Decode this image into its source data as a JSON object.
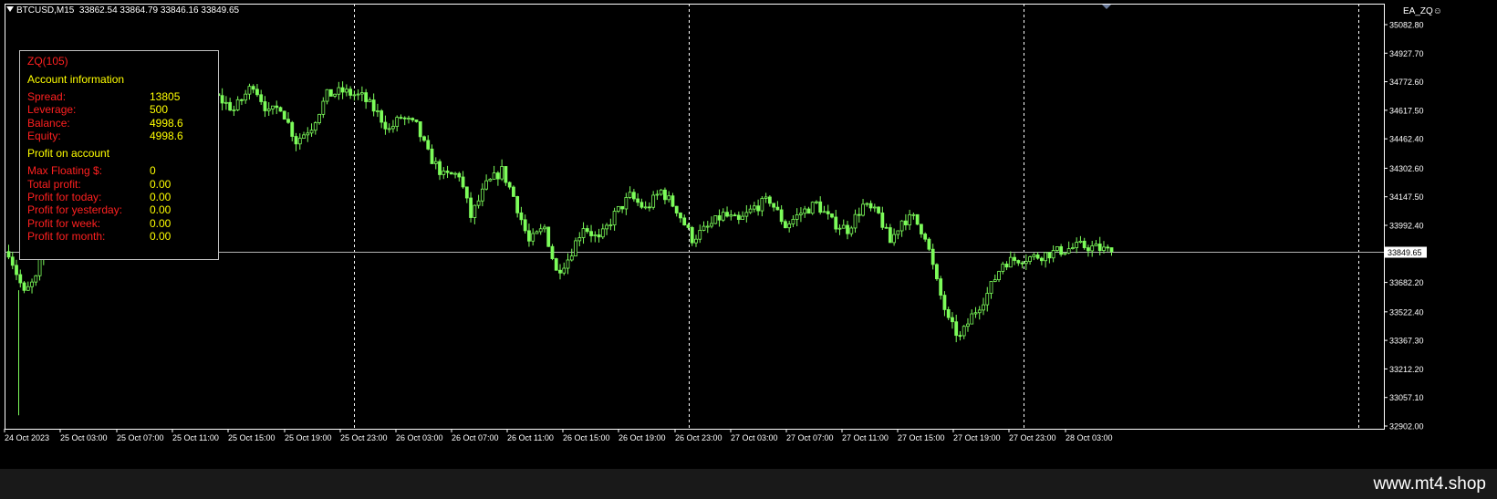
{
  "header": {
    "symbol": "BTCUSD,M15",
    "ohlc": "33862.54 33864.79 33846.16 33849.65"
  },
  "expert": {
    "label": "EA_ZQ",
    "smiley": "☺"
  },
  "panel": {
    "title": "ZQ(105)",
    "account_heading": "Account information",
    "account_rows": [
      {
        "label": "Spread:",
        "value": "13805"
      },
      {
        "label": "Leverage:",
        "value": "500"
      },
      {
        "label": "Balance:",
        "value": "4998.6"
      },
      {
        "label": "Equity:",
        "value": "4998.6"
      }
    ],
    "profit_heading": "Profit on account",
    "profit_rows": [
      {
        "label": "Max Floating $:",
        "value": "0"
      },
      {
        "label": "Total profit:",
        "value": "0.00"
      },
      {
        "label": "Profit for today:",
        "value": "0.00"
      },
      {
        "label": "Profit for yesterday:",
        "value": "0.00"
      },
      {
        "label": "Profit for week:",
        "value": "0.00"
      },
      {
        "label": "Profit for month:",
        "value": "0.00"
      }
    ]
  },
  "footer": {
    "brand": "www.mt4.shop"
  },
  "colors": {
    "candle": "#7cfc5a",
    "price_line": "#b4b4b4",
    "grid": "#ffffff",
    "label_red": "#ff2020",
    "label_yellow": "#ffff00"
  },
  "chart_data": {
    "type": "candlestick",
    "symbol": "BTCUSD",
    "timeframe": "M15",
    "current_price": 33849.65,
    "y_ticks": [
      35082.8,
      34927.7,
      34772.6,
      34617.5,
      34462.4,
      34302.6,
      34147.5,
      33992.4,
      33682.2,
      33522.4,
      33367.3,
      33212.2,
      33057.1,
      32902.0
    ],
    "ylim": [
      32902.0,
      35082.8
    ],
    "x_labels": [
      "24 Oct 2023",
      "25 Oct 03:00",
      "25 Oct 07:00",
      "25 Oct 11:00",
      "25 Oct 15:00",
      "25 Oct 19:00",
      "25 Oct 23:00",
      "26 Oct 03:00",
      "26 Oct 07:00",
      "26 Oct 11:00",
      "26 Oct 15:00",
      "26 Oct 19:00",
      "26 Oct 23:00",
      "27 Oct 03:00",
      "27 Oct 07:00",
      "27 Oct 11:00",
      "27 Oct 15:00",
      "27 Oct 19:00",
      "27 Oct 23:00",
      "28 Oct 03:00"
    ],
    "day_separators": [
      "25 Oct",
      "26 Oct",
      "27 Oct",
      "28 Oct"
    ],
    "close_path": [
      [
        0,
        33850
      ],
      [
        4,
        33620
      ],
      [
        7,
        33700
      ],
      [
        10,
        33960
      ],
      [
        12,
        33850
      ],
      [
        16,
        34000
      ],
      [
        22,
        33820
      ],
      [
        25,
        34150
      ],
      [
        32,
        34600
      ],
      [
        38,
        34600
      ],
      [
        42,
        34480
      ],
      [
        48,
        34630
      ],
      [
        53,
        34700
      ],
      [
        58,
        34620
      ],
      [
        63,
        34760
      ],
      [
        67,
        34600
      ],
      [
        70,
        34640
      ],
      [
        74,
        34450
      ],
      [
        78,
        34530
      ],
      [
        82,
        34700
      ],
      [
        86,
        34720
      ],
      [
        91,
        34690
      ],
      [
        95,
        34600
      ],
      [
        98,
        34510
      ],
      [
        101,
        34580
      ],
      [
        105,
        34530
      ],
      [
        108,
        34380
      ],
      [
        112,
        34260
      ],
      [
        116,
        34270
      ],
      [
        119,
        34040
      ],
      [
        123,
        34210
      ],
      [
        127,
        34290
      ],
      [
        130,
        34150
      ],
      [
        134,
        33900
      ],
      [
        138,
        33980
      ],
      [
        141,
        33740
      ],
      [
        144,
        33810
      ],
      [
        148,
        33990
      ],
      [
        152,
        33910
      ],
      [
        156,
        34050
      ],
      [
        160,
        34150
      ],
      [
        164,
        34080
      ],
      [
        168,
        34180
      ],
      [
        172,
        34080
      ],
      [
        176,
        33920
      ],
      [
        180,
        33980
      ],
      [
        184,
        34050
      ],
      [
        188,
        34010
      ],
      [
        192,
        34090
      ],
      [
        196,
        34130
      ],
      [
        200,
        33990
      ],
      [
        204,
        34060
      ],
      [
        208,
        34110
      ],
      [
        212,
        34010
      ],
      [
        216,
        33970
      ],
      [
        220,
        34100
      ],
      [
        224,
        34050
      ],
      [
        227,
        33900
      ],
      [
        230,
        34020
      ],
      [
        233,
        34030
      ],
      [
        236,
        33940
      ],
      [
        239,
        33680
      ],
      [
        242,
        33470
      ],
      [
        245,
        33380
      ],
      [
        248,
        33500
      ],
      [
        252,
        33620
      ],
      [
        256,
        33790
      ],
      [
        260,
        33810
      ],
      [
        264,
        33820
      ],
      [
        268,
        33840
      ],
      [
        272,
        33860
      ],
      [
        276,
        33880
      ],
      [
        280,
        33870
      ],
      [
        284,
        33849.65
      ]
    ]
  }
}
